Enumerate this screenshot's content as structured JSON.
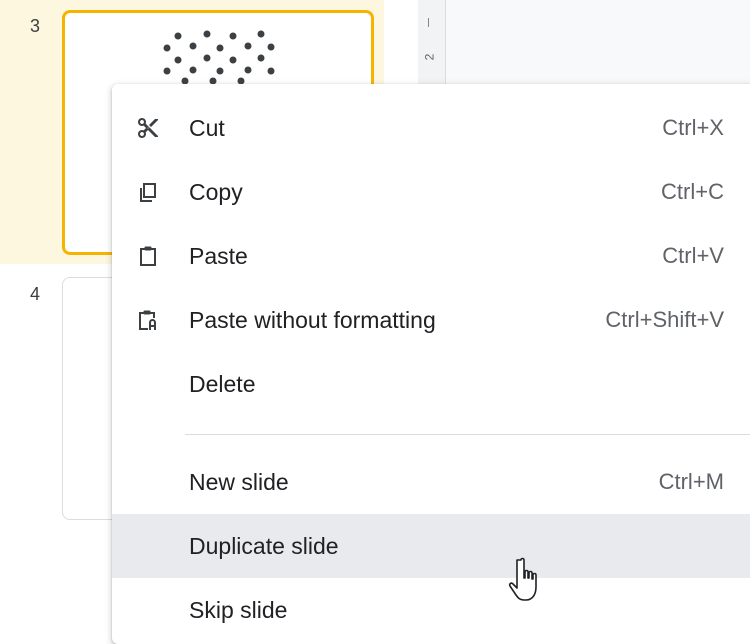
{
  "filmstrip": {
    "slides": [
      {
        "number": "3",
        "selected": true
      },
      {
        "number": "4",
        "selected": false
      }
    ]
  },
  "ruler": {
    "number": "2"
  },
  "colors": {
    "selection_border": "#f4b400",
    "selection_bg": "#fef7e0",
    "hover_bg": "#e8eaed"
  },
  "context_menu": {
    "items": [
      {
        "label": "Cut",
        "shortcut": "Ctrl+X",
        "icon": "scissors-icon"
      },
      {
        "label": "Copy",
        "shortcut": "Ctrl+C",
        "icon": "copy-icon"
      },
      {
        "label": "Paste",
        "shortcut": "Ctrl+V",
        "icon": "clipboard-icon"
      },
      {
        "label": "Paste without formatting",
        "shortcut": "Ctrl+Shift+V",
        "icon": "clipboard-text-icon"
      },
      {
        "label": "Delete",
        "shortcut": ""
      },
      {
        "label": "New slide",
        "shortcut": "Ctrl+M"
      },
      {
        "label": "Duplicate slide",
        "shortcut": "",
        "hovered": true
      },
      {
        "label": "Skip slide",
        "shortcut": ""
      }
    ]
  }
}
